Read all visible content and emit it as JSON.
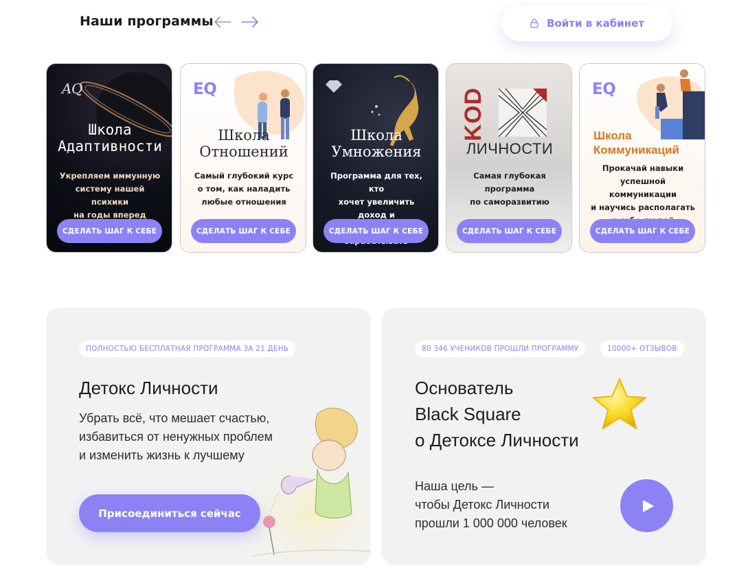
{
  "header": {
    "title": "Наши программы",
    "login_label": "Войти в кабинет"
  },
  "programs": [
    {
      "badge": "AQ",
      "name_line1": "Школа",
      "name_line2": "Адаптивности",
      "desc": [
        "Укрепляем иммунную",
        "систему нашей психики",
        "на годы вперед"
      ],
      "cta": "СДЕЛАТЬ ШАГ К СЕБЕ"
    },
    {
      "badge": "EQ",
      "name_line1": "Школа",
      "name_line2": "Отношений",
      "desc": [
        "Самый глубокий курс",
        "о том, как наладить",
        "любые отношения"
      ],
      "cta": "СДЕЛАТЬ ШАГ К СЕБЕ"
    },
    {
      "badge": "",
      "name_line1": "Школа",
      "name_line2": "Умножения",
      "desc": [
        "Программа для тех, кто",
        "хочет увеличить доход и",
        "научиться зарабатывать"
      ],
      "cta": "СДЕЛАТЬ ШАГ К СЕБЕ"
    },
    {
      "badge": "KOD",
      "name_line1": "",
      "name_line2": "ЛИЧНОСТИ",
      "desc": [
        "Самая глубокая",
        "программа",
        "по саморазвитию"
      ],
      "cta": "СДЕЛАТЬ ШАГ К СЕБЕ"
    },
    {
      "badge": "EQ",
      "name_line1": "Школа",
      "name_line2": "Коммуникаций",
      "desc": [
        "Прокачай навыки",
        "успешной коммуникации",
        "и научись располагать",
        "к себе людей"
      ],
      "cta": "СДЕЛАТЬ ШАГ К СЕБЕ"
    }
  ],
  "detox": {
    "pill": "ПОЛНОСТЬЮ БЕСПЛАТНАЯ ПРОГРАММА ЗА 21 ДЕНЬ",
    "title": "Детокс Личности",
    "text": [
      "Убрать всё, что мешает счастью,",
      "избавиться от ненужных проблем",
      "и изменить жизнь к лучшему"
    ],
    "button": "Присоединиться сейчас"
  },
  "founder": {
    "pill_students": "80 346 УЧЕНИКОВ ПРОШЛИ ПРОГРАММУ",
    "pill_reviews": "10000+ ОТЗЫВОВ",
    "title": [
      "Основатель",
      "Black Square",
      "о Детоксе Личности"
    ],
    "text": [
      "Наша цель —",
      "чтобы Детокс Личности",
      "прошли 1 000 000 человек"
    ]
  },
  "colors": {
    "accent": "#8c82f6",
    "accent_text": "#8a82f0",
    "panel_bg": "#f2f2f3",
    "card_orange": "#d7781e",
    "kod_red": "#b02a2a"
  },
  "icons": [
    "arrow-left-icon",
    "arrow-right-icon",
    "lock-icon",
    "play-icon",
    "star-icon",
    "diamond-icon"
  ]
}
